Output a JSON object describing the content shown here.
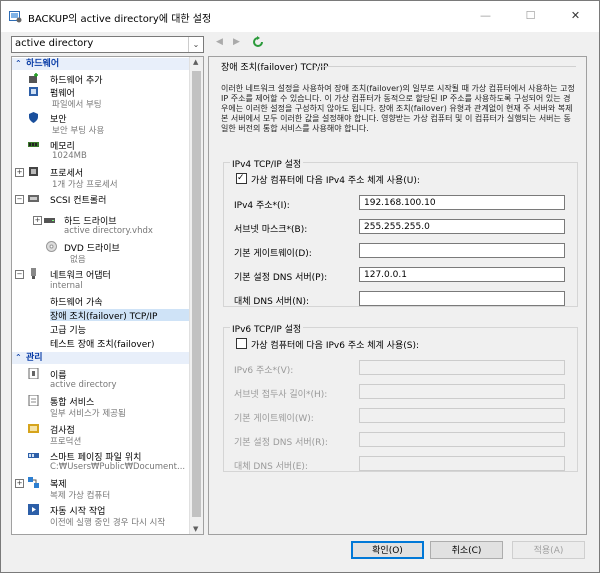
{
  "window": {
    "title": "BACKUP의 active directory에 대한 설정",
    "minimize": "—",
    "maximize": "☐",
    "close": "✕"
  },
  "toolbar": {
    "vm_select": "active directory",
    "back": "◀",
    "forward": "▶"
  },
  "tree": {
    "hardware_header": "하드웨어",
    "management_header": "관리",
    "hw": [
      {
        "label": "하드웨어 추가"
      },
      {
        "label": "펌웨어",
        "sub": "파일에서 부팅"
      },
      {
        "label": "보안",
        "sub": "보안 부팅 사용"
      },
      {
        "label": "메모리",
        "sub": "1024MB"
      },
      {
        "label": "프로세서",
        "sub": "1개 가상 프로세서"
      },
      {
        "label": "SCSI 컨트롤러"
      },
      {
        "label": "하드 드라이브",
        "sub": "active directory.vhdx"
      },
      {
        "label": "DVD 드라이브",
        "sub": "없음"
      },
      {
        "label": "네트워크 어댑터",
        "sub": "internal"
      },
      {
        "label": "하드웨어 가속"
      },
      {
        "label": "장애 조치(failover) TCP/IP"
      },
      {
        "label": "고급 기능"
      },
      {
        "label": "테스트 장애 조치(failover)"
      }
    ],
    "mgmt": [
      {
        "label": "이름",
        "sub": "active directory"
      },
      {
        "label": "통합 서비스",
        "sub": "일부 서비스가 제공됨"
      },
      {
        "label": "검사점",
        "sub": "프로덕션"
      },
      {
        "label": "스마트 페이징 파일 위치",
        "sub": "C:₩Users₩Public₩Document..."
      },
      {
        "label": "복제",
        "sub": "복제 가상 컴퓨터"
      },
      {
        "label": "자동 시작 작업",
        "sub": "이전에 실행 중인 경우 다시 시작"
      }
    ]
  },
  "panel": {
    "title": "장애 조치(failover) TCP/IP",
    "description": "이러한 네트워크 설정을 사용하여 장애 조치(failover)의 일부로 시작될 때 가상 컴퓨터에서 사용하는 고정 IP 주소를 제어할 수 있습니다. 이 가상 컴퓨터가 동적으로 할당된 IP 주소를 사용하도록 구성되어 있는 경우에는 이러한 설정을 구성하지 않아도 됩니다. 장애 조치(failover) 유형과 관계없이 현재 주 서버와 복제본 서버에서 모두 이러한 값을 설정해야 합니다. 영향받는 가상 컴퓨터 및 이 컴퓨터가 실행되는 서버는 동일한 버전의 통합 서비스를 사용해야 합니다.",
    "ipv4": {
      "group_title": "IPv4 TCP/IP 설정",
      "checkbox_label": "가상 컴퓨터에 다음 IPv4 주소 체계 사용(U):",
      "checked": true,
      "fields": [
        {
          "label": "IPv4 주소*(I):",
          "value": "192.168.100.10"
        },
        {
          "label": "서브넷 마스크*(B):",
          "value": "255.255.255.0"
        },
        {
          "label": "기본 게이트웨이(D):",
          "value": ""
        },
        {
          "label": "기본 설정 DNS 서버(P):",
          "value": "127.0.0.1"
        },
        {
          "label": "대체 DNS 서버(N):",
          "value": ""
        }
      ]
    },
    "ipv6": {
      "group_title": "IPv6 TCP/IP 설정",
      "checkbox_label": "가상 컴퓨터에 다음 IPv6 주소 체계 사용(S):",
      "checked": false,
      "fields": [
        {
          "label": "IPv6 주소*(V):",
          "value": ""
        },
        {
          "label": "서브넷 접두사 길이*(H):",
          "value": ""
        },
        {
          "label": "기본 게이트웨이(W):",
          "value": ""
        },
        {
          "label": "기본 설정 DNS 서버(R):",
          "value": ""
        },
        {
          "label": "대체 DNS 서버(E):",
          "value": ""
        }
      ]
    }
  },
  "buttons": {
    "ok": "확인(O)",
    "cancel": "취소(C)",
    "apply": "적용(A)"
  }
}
